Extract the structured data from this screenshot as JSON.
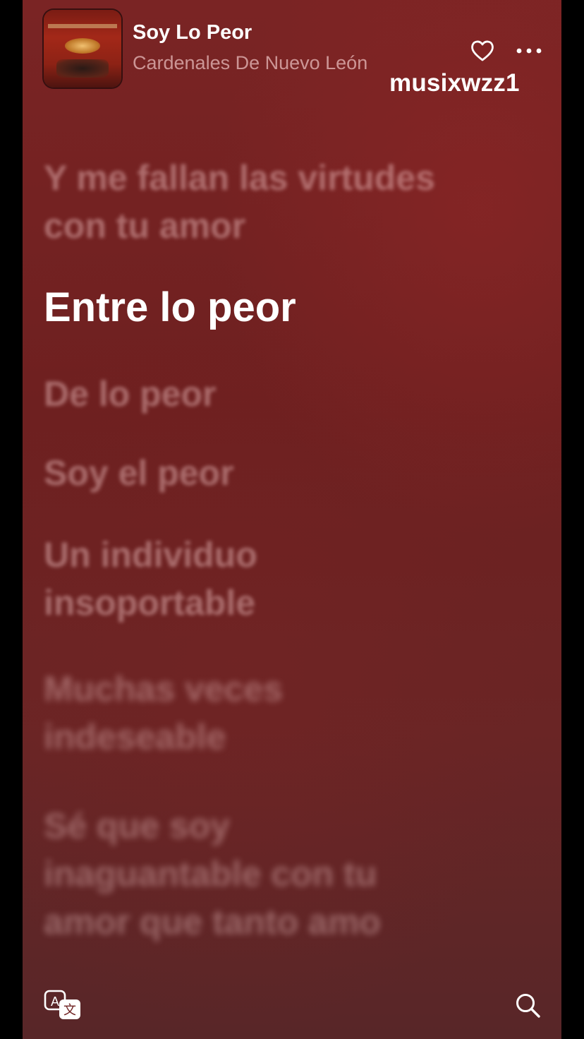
{
  "now_playing": {
    "title": "Soy Lo Peor",
    "artist": "Cardenales De Nuevo León",
    "artwork_icon": "album-artwork"
  },
  "header_actions": {
    "favorite_icon": "heart-outline-icon",
    "more_icon": "ellipsis-icon"
  },
  "watermark": "musixwzz1",
  "lyrics": {
    "lines": [
      "Y me fallan las virtudes con tu amor",
      "Entre lo peor",
      "De lo peor",
      "Soy el peor",
      "Un individuo insoportable",
      "Muchas veces indeseable",
      "Sé que soy inaguantable con tu amor que tanto amo"
    ],
    "active_index": 1
  },
  "bottom_actions": {
    "translate_icon": "translate-icon",
    "search_icon": "search-icon"
  },
  "colors": {
    "background": "#6e2020",
    "active_lyric": "#ffffff",
    "inactive_lyric": "rgba(255,215,215,0.42)"
  }
}
